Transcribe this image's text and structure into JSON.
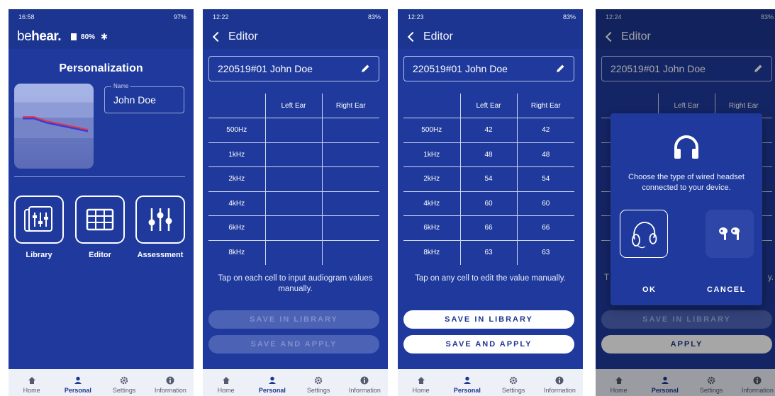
{
  "screens": [
    {
      "status_time": "16:58",
      "status_right": "97%",
      "brand_prefix": "be",
      "brand_suffix": "hear.",
      "battery": "80%",
      "title": "Personalization",
      "name_label": "Name",
      "name_value": "John Doe",
      "tiles": [
        {
          "label": "Library",
          "icon": "library-icon"
        },
        {
          "label": "Editor",
          "icon": "editor-grid-icon"
        },
        {
          "label": "Assessment",
          "icon": "sliders-icon"
        }
      ]
    },
    {
      "status_time": "12:22",
      "status_right": "83%",
      "header": "Editor",
      "profile_name": "220519#01 John Doe",
      "hint": "Tap on each cell to input audiogram values manually.",
      "save_library": "SAVE IN LIBRARY",
      "save_apply": "SAVE AND APPLY"
    },
    {
      "status_time": "12:23",
      "status_right": "83%",
      "header": "Editor",
      "profile_name": "220519#01 John Doe",
      "hint": "Tap on any cell to edit the value manually.",
      "save_library": "SAVE IN LIBRARY",
      "save_apply": "SAVE AND APPLY"
    },
    {
      "status_time": "12:24",
      "status_right": "83%",
      "header": "Editor",
      "profile_name": "220519#01 John Doe",
      "table_left": "Left Ear",
      "table_right": "Right Ear",
      "hint_left": "T",
      "hint_right": "y.",
      "save_library": "SAVE IN LIBRARY",
      "apply": "APPLY",
      "dialog": {
        "message": "Choose the type of wired headset connected to your device.",
        "ok": "OK",
        "cancel": "CANCEL"
      }
    }
  ],
  "table": {
    "headers": [
      "",
      "Left Ear",
      "Right Ear"
    ],
    "frequencies": [
      "500Hz",
      "1kHz",
      "2kHz",
      "4kHz",
      "6kHz",
      "8kHz"
    ],
    "left": [
      "42",
      "48",
      "54",
      "60",
      "66",
      "63"
    ],
    "right": [
      "42",
      "48",
      "54",
      "60",
      "66",
      "63"
    ]
  },
  "nav": [
    "Home",
    "Personal",
    "Settings",
    "Information"
  ],
  "colors": {
    "background": "#1f3a9c",
    "header": "#1c3590",
    "chart_red": "#e8364a",
    "chart_blue": "#3340d8"
  }
}
